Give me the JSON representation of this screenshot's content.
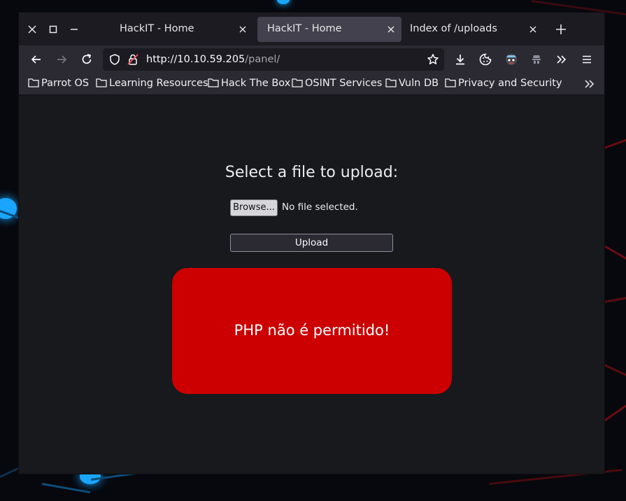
{
  "tabs": [
    {
      "label": "HackIT - Home",
      "active": false
    },
    {
      "label": "HackIT - Home",
      "active": true
    },
    {
      "label": "Index of /uploads",
      "active": false
    }
  ],
  "address_bar": {
    "host": "http://10.10.59.205",
    "path": "/panel/"
  },
  "bookmarks": [
    {
      "label": "Parrot OS"
    },
    {
      "label": "Learning Resources"
    },
    {
      "label": "Hack The Box"
    },
    {
      "label": "OSINT Services"
    },
    {
      "label": "Vuln DB"
    },
    {
      "label": "Privacy and Security"
    }
  ],
  "page": {
    "title": "Select a file to upload:",
    "browse_label": "Browse...",
    "file_status": "No file selected.",
    "upload_label": "Upload",
    "error_message": "PHP não é permitido!"
  },
  "colors": {
    "error_bg": "#cc0000",
    "browser_bg": "#1c1b22",
    "content_bg": "#18191c"
  }
}
